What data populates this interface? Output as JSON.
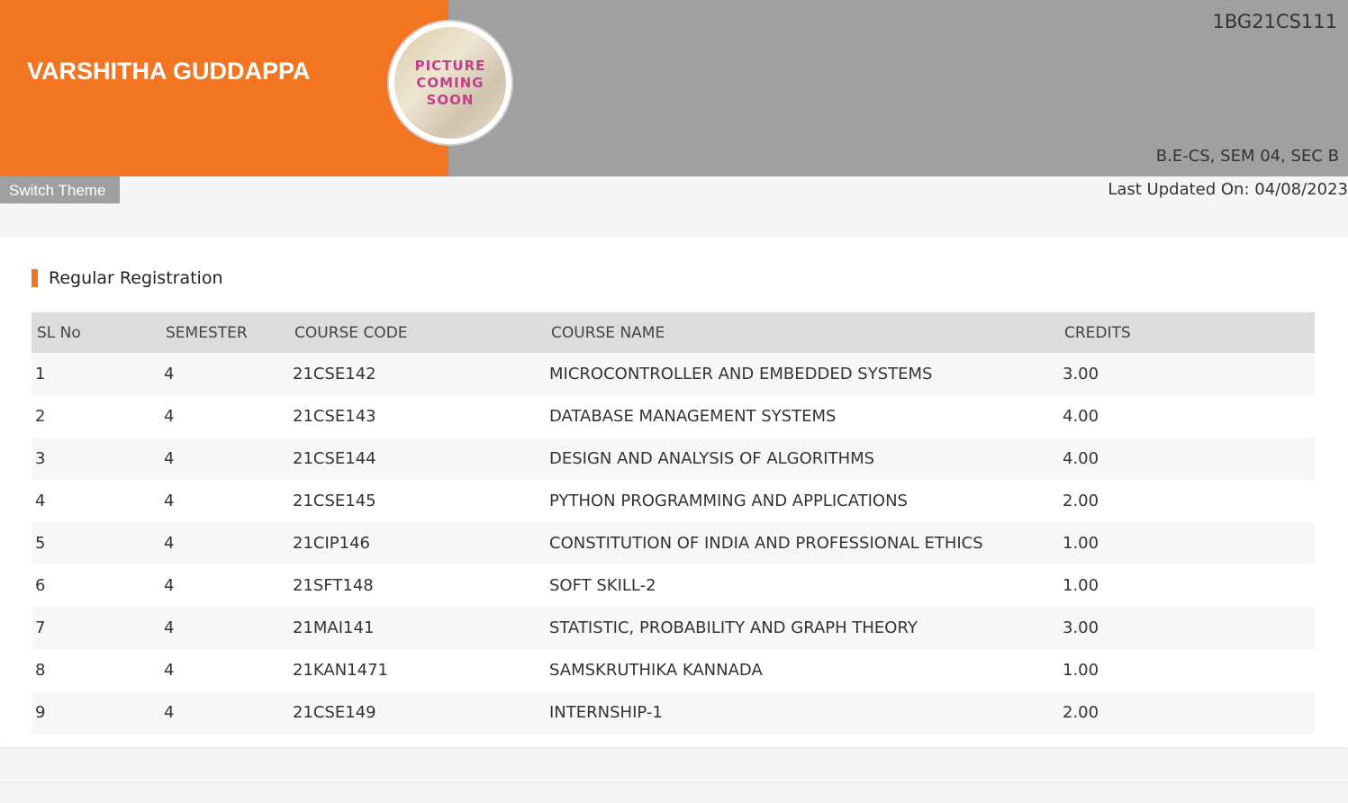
{
  "header": {
    "student_name": "VARSHITHA GUDDAPPA",
    "usn": "1BG21CS111",
    "program": "B.E-CS, SEM 04, SEC B",
    "avatar_text": "PICTURE\nCOMING\nSOON",
    "colors": {
      "accent": "#f37421",
      "header_gray": "#a0a0a0"
    }
  },
  "toolbar": {
    "switch_theme_label": "Switch Theme",
    "last_updated": "Last Updated On: 04/08/2023"
  },
  "registration": {
    "title": "Regular Registration",
    "columns": [
      "SL No",
      "SEMESTER",
      "COURSE CODE",
      "COURSE NAME",
      "CREDITS"
    ],
    "rows": [
      [
        "1",
        "4",
        "21CSE142",
        "MICROCONTROLLER AND EMBEDDED SYSTEMS",
        "3.00"
      ],
      [
        "2",
        "4",
        "21CSE143",
        "DATABASE MANAGEMENT SYSTEMS",
        "4.00"
      ],
      [
        "3",
        "4",
        "21CSE144",
        "DESIGN AND ANALYSIS OF ALGORITHMS",
        "4.00"
      ],
      [
        "4",
        "4",
        "21CSE145",
        "PYTHON PROGRAMMING AND APPLICATIONS",
        "2.00"
      ],
      [
        "5",
        "4",
        "21CIP146",
        "CONSTITUTION OF INDIA AND PROFESSIONAL ETHICS",
        "1.00"
      ],
      [
        "6",
        "4",
        "21SFT148",
        "SOFT SKILL-2",
        "1.00"
      ],
      [
        "7",
        "4",
        "21MAI141",
        "STATISTIC, PROBABILITY AND GRAPH THEORY",
        "3.00"
      ],
      [
        "8",
        "4",
        "21KAN1471",
        "SAMSKRUTHIKA KANNADA",
        "1.00"
      ],
      [
        "9",
        "4",
        "21CSE149",
        "INTERNSHIP-1",
        "2.00"
      ]
    ]
  }
}
